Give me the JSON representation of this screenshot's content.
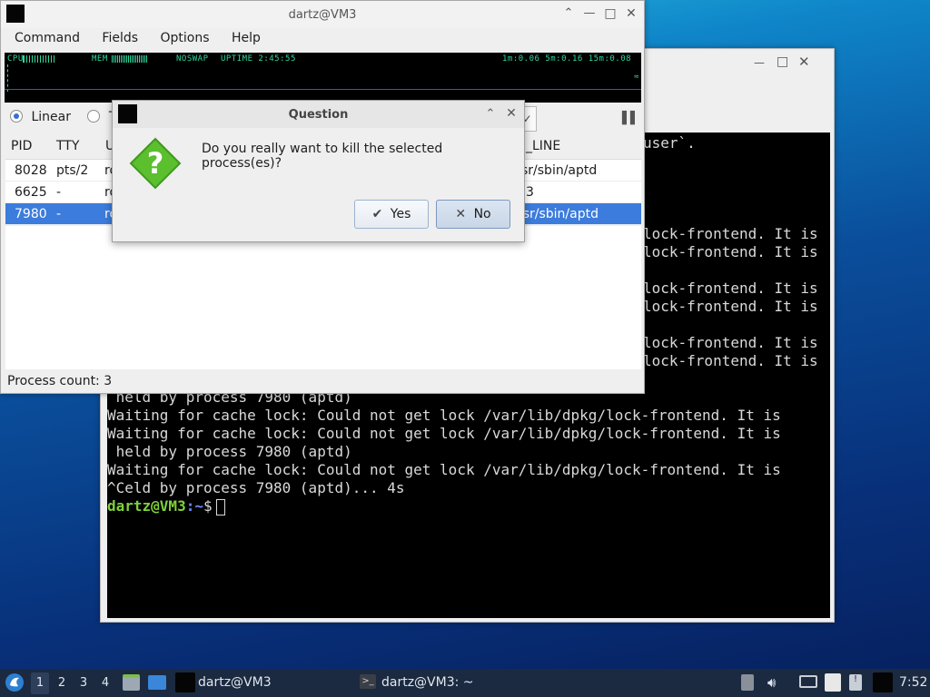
{
  "terminal": {
    "lines_prefix": [
      {
        "text": "user`.",
        "row": 0
      },
      {
        "text": "lock-frontend. It is",
        "row": 1
      },
      {
        "text": "lock-frontend. It is",
        "row": 2
      }
    ],
    "visible_partial": [
      "user`.",
      "lock-frontend. It is",
      "lock-frontend. It is",
      "lock-frontend. It is",
      "lock-frontend. It is",
      "lock-frontend. It is",
      "lock-frontend. It is"
    ],
    "full_lines": [
      " held by process 7980 (aptd)",
      "Waiting for cache lock: Could not get lock /var/lib/dpkg/lock-frontend. It is",
      "Waiting for cache lock: Could not get lock /var/lib/dpkg/lock-frontend. It is",
      " held by process 7980 (aptd)",
      "Waiting for cache lock: Could not get lock /var/lib/dpkg/lock-frontend. It is",
      "^Celd by process 7980 (aptd)... 4s"
    ],
    "prompt_user": "dartz@VM3",
    "prompt_path": ":~",
    "prompt_symbol": "$"
  },
  "htop": {
    "title": "dartz@VM3",
    "menu": [
      "Command",
      "Fields",
      "Options",
      "Help"
    ],
    "meter": {
      "cpu": "CPU",
      "mem": "MEM",
      "swap": "NOSWAP",
      "uptime": "UPTIME 2:45:55",
      "load": "1m:0.06 5m:0.16 15m:0.08"
    },
    "view_linear": "Linear",
    "view_tree": "Tr",
    "columns": {
      "pid": "PID",
      "tty": "TTY",
      "user": "U",
      "cmd": "_LINE"
    },
    "rows": [
      {
        "pid": "8028",
        "tty": "pts/2",
        "user": "ro",
        "cmd": "sr/sbin/aptd"
      },
      {
        "pid": "6625",
        "tty": "-",
        "user": "ro",
        "cmd": "3"
      },
      {
        "pid": "7980",
        "tty": "-",
        "user": "ro",
        "cmd": "/sr/sbin/aptd"
      }
    ],
    "status": "Process count: 3"
  },
  "dialog": {
    "title": "Question",
    "message": "Do you really want to kill the selected process(es)?",
    "yes_label": "Yes",
    "no_label": "No",
    "yes_icon": "check-icon",
    "no_icon": "x-icon"
  },
  "taskbar": {
    "workspaces": [
      "1",
      "2",
      "3",
      "4"
    ],
    "active_workspace": "1",
    "tasks": [
      "dartz@VM3",
      "dartz@VM3: ~"
    ],
    "clock": "7:52"
  },
  "colors": {
    "selection": "#3c7cdc",
    "question_icon": "#5bbf2e",
    "prompt_user": "#7fd13b",
    "prompt_path": "#6b8cff"
  }
}
